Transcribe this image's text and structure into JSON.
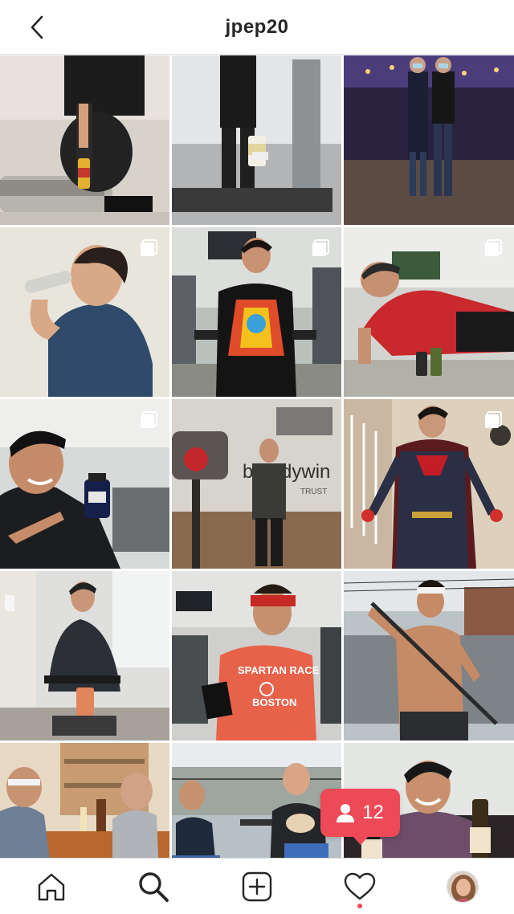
{
  "header": {
    "username": "jpep20",
    "back_icon": "chevron-left-icon"
  },
  "grid": {
    "posts": [
      {
        "description": "man tying shoe by treadmill",
        "multi": false
      },
      {
        "description": "gym equipment with keto bottle",
        "multi": false
      },
      {
        "description": "two men in masks at arena",
        "multi": false
      },
      {
        "description": "drinking from bottle",
        "multi": true
      },
      {
        "description": "dumbbell curls in colorful tee",
        "multi": true
      },
      {
        "description": "side plank in red shirt",
        "multi": true
      },
      {
        "description": "pointing at supplement bottle",
        "multi": true
      },
      {
        "description": "standing in front of camera",
        "multi": false
      },
      {
        "description": "superman costume",
        "multi": true
      },
      {
        "description": "rowing machine",
        "multi": false
      },
      {
        "description": "spartan race boston shirt",
        "multi": false
      },
      {
        "description": "shirtless with rope",
        "multi": false
      },
      {
        "description": "two men at kitchen counter",
        "multi": false
      },
      {
        "description": "two men on patio with dog",
        "multi": false
      },
      {
        "description": "holding wine bottles",
        "multi": false
      }
    ]
  },
  "activity": {
    "count": "12",
    "icon": "user-icon",
    "color": "#ed4956"
  },
  "tabbar": {
    "items": [
      "home-icon",
      "search-icon",
      "new-post-icon",
      "heart-icon",
      "profile-avatar"
    ]
  }
}
